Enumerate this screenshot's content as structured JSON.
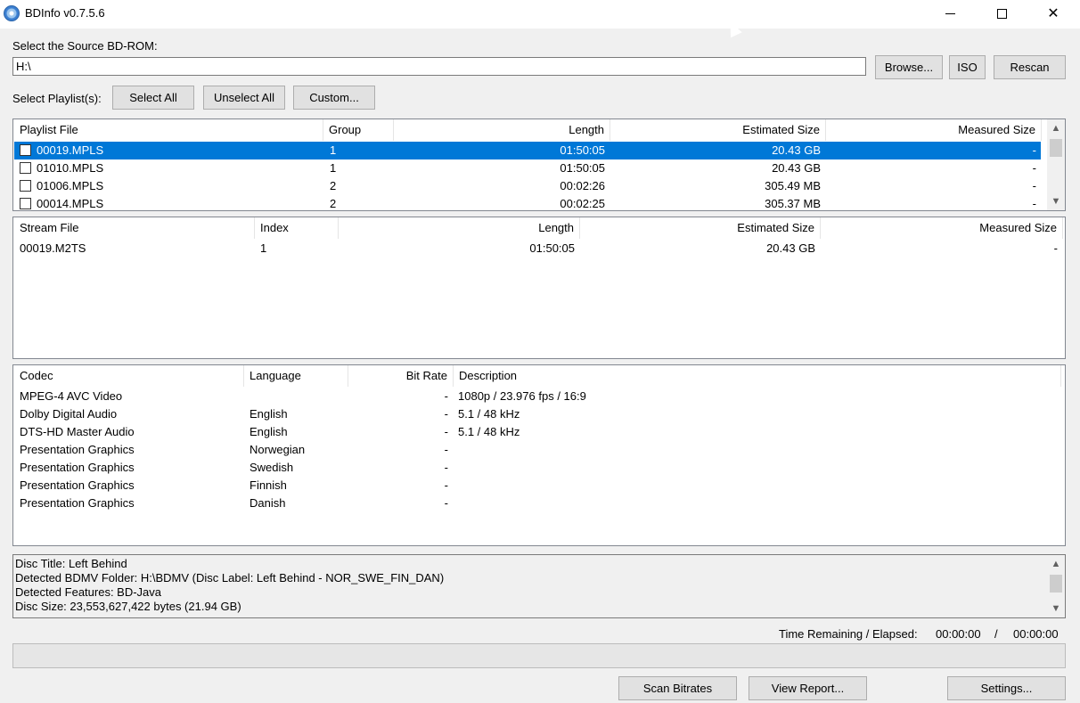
{
  "window": {
    "title": "BDInfo v0.7.5.6"
  },
  "source": {
    "label": "Select the Source BD-ROM:",
    "value": "H:\\",
    "browse": "Browse...",
    "iso": "ISO",
    "rescan": "Rescan"
  },
  "playlist_controls": {
    "label": "Select Playlist(s):",
    "select_all": "Select All",
    "unselect_all": "Unselect All",
    "custom": "Custom..."
  },
  "playlists": {
    "headers": [
      "Playlist File",
      "Group",
      "Length",
      "Estimated Size",
      "Measured Size"
    ],
    "rows": [
      {
        "file": "00019.MPLS",
        "group": "1",
        "length": "01:50:05",
        "est": "20.43 GB",
        "measured": "-",
        "selected": true
      },
      {
        "file": "01010.MPLS",
        "group": "1",
        "length": "01:50:05",
        "est": "20.43 GB",
        "measured": "-",
        "selected": false
      },
      {
        "file": "01006.MPLS",
        "group": "2",
        "length": "00:02:26",
        "est": "305.49 MB",
        "measured": "-",
        "selected": false
      },
      {
        "file": "00014.MPLS",
        "group": "2",
        "length": "00:02:25",
        "est": "305.37 MB",
        "measured": "-",
        "selected": false
      }
    ]
  },
  "streams": {
    "headers": [
      "Stream File",
      "Index",
      "Length",
      "Estimated Size",
      "Measured Size"
    ],
    "rows": [
      {
        "file": "00019.M2TS",
        "index": "1",
        "length": "01:50:05",
        "est": "20.43 GB",
        "measured": "-"
      }
    ]
  },
  "codecs": {
    "headers": [
      "Codec",
      "Language",
      "Bit Rate",
      "Description"
    ],
    "rows": [
      {
        "codec": "MPEG-4 AVC Video",
        "language": "",
        "bitrate": "-",
        "description": "1080p / 23.976 fps / 16:9"
      },
      {
        "codec": "Dolby Digital Audio",
        "language": "English",
        "bitrate": "-",
        "description": "5.1 / 48 kHz"
      },
      {
        "codec": "DTS-HD Master Audio",
        "language": "English",
        "bitrate": "-",
        "description": "5.1 / 48 kHz"
      },
      {
        "codec": "Presentation Graphics",
        "language": "Norwegian",
        "bitrate": "-",
        "description": ""
      },
      {
        "codec": "Presentation Graphics",
        "language": "Swedish",
        "bitrate": "-",
        "description": ""
      },
      {
        "codec": "Presentation Graphics",
        "language": "Finnish",
        "bitrate": "-",
        "description": ""
      },
      {
        "codec": "Presentation Graphics",
        "language": "Danish",
        "bitrate": "-",
        "description": ""
      }
    ]
  },
  "disc_info": [
    "Disc Title: Left Behind",
    "Detected BDMV Folder: H:\\BDMV (Disc Label: Left Behind - NOR_SWE_FIN_DAN)",
    "Detected Features: BD-Java",
    "Disc Size: 23,553,627,422 bytes (21.94 GB)"
  ],
  "status": {
    "label": "Time Remaining / Elapsed:",
    "remaining": "00:00:00",
    "sep": "/",
    "elapsed": "00:00:00",
    "progress": 0
  },
  "footer": {
    "scan": "Scan Bitrates",
    "report": "View Report...",
    "settings": "Settings..."
  },
  "icons": {
    "app": "bluray-disc-icon",
    "up": "▲",
    "down": "▼"
  }
}
